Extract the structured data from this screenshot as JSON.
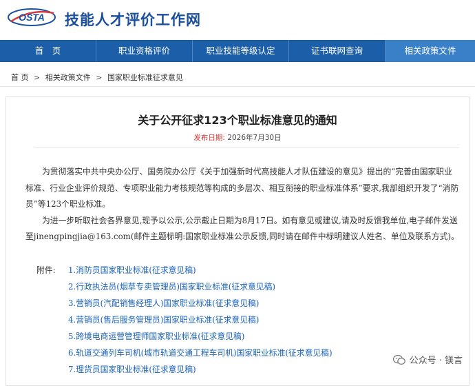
{
  "site": {
    "logo_text": "OSTA",
    "title": "技能人才评价工作网"
  },
  "nav": {
    "items": [
      {
        "label": "首　页"
      },
      {
        "label": "职业资格评价"
      },
      {
        "label": "职业技能等级认定"
      },
      {
        "label": "证书联网查询"
      },
      {
        "label": "相关政策文件"
      }
    ]
  },
  "breadcrumb": {
    "home": "首 页",
    "sep": ">",
    "section": "相关政策文件",
    "current": "国家职业标准征求意见"
  },
  "article": {
    "title": "关于公开征求123个职业标准意见的通知",
    "date_label": "发布日期:",
    "date": "2026年7月30日",
    "paragraph1": "为贯彻落实中共中央办公厅、国务院办公厅《关于加强新时代高技能人才队伍建设的意见》提出的“完善由国家职业标准、行业企业评价规范、专项职业能力考核规范等构成的多层次、相互衔接的职业标准体系”要求,我部组织开发了“消防员”等123个职业标准。",
    "paragraph2": "为进一步听取社会各界意见,现予以公示,公示截止日期为8月17日。如有意见或建议,请及时反馈我单位,电子邮件发送至jinengpingjia@163.com(邮件主题标明:国家职业标准公示反馈,同时请在邮件中标明建议人姓名、单位及联系方式)。",
    "attach_label": "附件:",
    "attachments": [
      "1.消防员国家职业标准(征求意见稿)",
      "2.行政执法员(烟草专卖管理员)国家职业标准(征求意见稿)",
      "3.营销员(汽配销售经理人)国家职业标准(征求意见稿)",
      "4.营销员(售后服务管理员)国家职业标准(征求意见稿)",
      "5.跨境电商运营管理师国家职业标准(征求意见稿)",
      "6.轨道交通列车司机(城市轨道交通工程车司机)国家职业标准(征求意见稿)",
      "7.理货员国家职业标准(征求意见稿)"
    ]
  },
  "watermark": {
    "text": "公众号 · 镁言"
  },
  "colors": {
    "nav_bg": "#1d5ea8",
    "nav_active": "#3a80c8",
    "link": "#1a63b8",
    "date_label": "#d63a3a",
    "title_blue": "#1a4fa0"
  }
}
